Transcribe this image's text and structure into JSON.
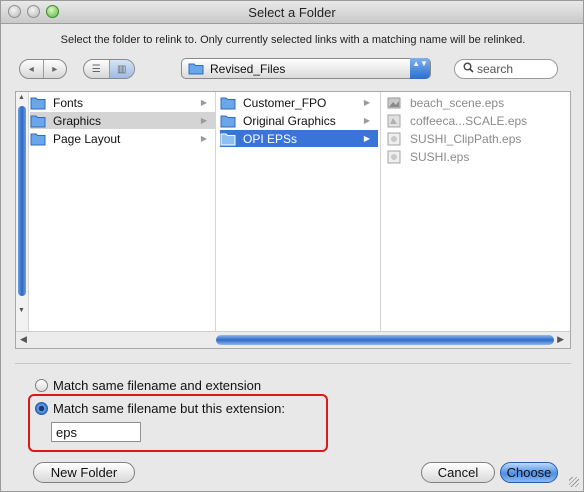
{
  "window": {
    "title": "Select a Folder"
  },
  "instruction": "Select the folder to relink to. Only currently selected links with a matching name will be relinked.",
  "toolbar": {
    "back_glyph": "◂",
    "forward_glyph": "▸",
    "view_list_glyph": "☰",
    "view_column_glyph": "▥",
    "location": "Revised_Files",
    "popup_arrows": "▲▼",
    "search_placeholder": "search",
    "search_icon_glyph": "🔍"
  },
  "browser": {
    "column1": [
      {
        "label": "Fonts",
        "icon": "folder-icon",
        "state": "normal"
      },
      {
        "label": "Graphics",
        "icon": "folder-icon",
        "state": "selected-inactive"
      },
      {
        "label": "Page Layout",
        "icon": "folder-icon",
        "state": "normal"
      }
    ],
    "column2": [
      {
        "label": "Customer_FPO",
        "icon": "folder-icon",
        "state": "normal"
      },
      {
        "label": "Original Graphics",
        "icon": "folder-icon",
        "state": "normal"
      },
      {
        "label": "OPI EPSs",
        "icon": "folder-icon",
        "state": "selected"
      }
    ],
    "column3": [
      {
        "label": "beach_scene.eps",
        "icon": "image-file-icon"
      },
      {
        "label": "coffeeca...SCALE.eps",
        "icon": "image-file-icon"
      },
      {
        "label": "SUSHI_ClipPath.eps",
        "icon": "eps-file-icon"
      },
      {
        "label": "SUSHI.eps",
        "icon": "eps-file-icon"
      }
    ],
    "expand_glyph": "▶"
  },
  "options": {
    "radio1_label": "Match same filename and extension",
    "radio2_label": "Match same filename but this extension:",
    "radio1_selected": false,
    "radio2_selected": true,
    "extension_value": "eps"
  },
  "buttons": {
    "new_folder": "New Folder",
    "cancel": "Cancel",
    "choose": "Choose"
  },
  "colors": {
    "selection_blue": "#3875d7",
    "highlight_red": "#d71a1a",
    "folder_blue": "#4a90e2"
  }
}
